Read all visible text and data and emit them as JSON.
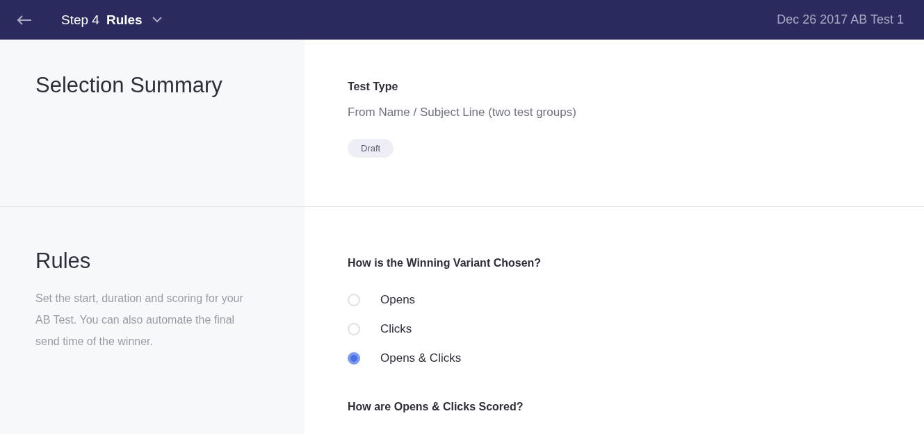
{
  "header": {
    "step": "Step 4",
    "title": "Rules",
    "test_name": "Dec 26 2017 AB Test 1"
  },
  "summary": {
    "heading": "Selection Summary",
    "label": "Test Type",
    "value": "From Name / Subject Line (two test groups)",
    "status": "Draft"
  },
  "rules": {
    "heading": "Rules",
    "description": "Set the start, duration and scoring for your AB Test. You can also automate the final send time of the winner.",
    "question": "How is the Winning Variant Chosen?",
    "options": [
      {
        "label": "Opens",
        "selected": false
      },
      {
        "label": "Clicks",
        "selected": false
      },
      {
        "label": "Opens & Clicks",
        "selected": true
      }
    ],
    "next_question": "How are Opens & Clicks Scored?"
  }
}
